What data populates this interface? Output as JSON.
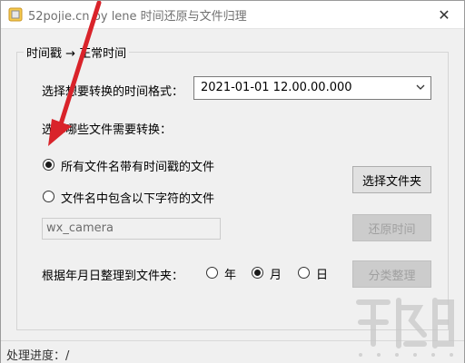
{
  "window": {
    "title": "52pojie.cn by lene 时间还原与文件归理",
    "close_glyph": "✕"
  },
  "group": {
    "legend": "时间戳 → 正常时间"
  },
  "format": {
    "label": "选择想要转换的时间格式：",
    "selected": "2021-01-01 12.00.00.000"
  },
  "files": {
    "label": "选择哪些文件需要转换：",
    "option_all": "所有文件名带有时间戳的文件",
    "option_contains": "文件名中包含以下字符的文件",
    "selected_option": "option_all",
    "filter_value": "wx_camera"
  },
  "buttons": {
    "select_folder": "选择文件夹",
    "restore_time": "还原时间",
    "classify": "分类整理"
  },
  "organize": {
    "label": "根据年月日整理到文件夹：",
    "year": "年",
    "month": "月",
    "day": "日",
    "selected": "month"
  },
  "status": {
    "text": "处理进度：/"
  },
  "colors": {
    "annotation_arrow": "#d9232a",
    "window_bg": "#f0f0f0"
  }
}
